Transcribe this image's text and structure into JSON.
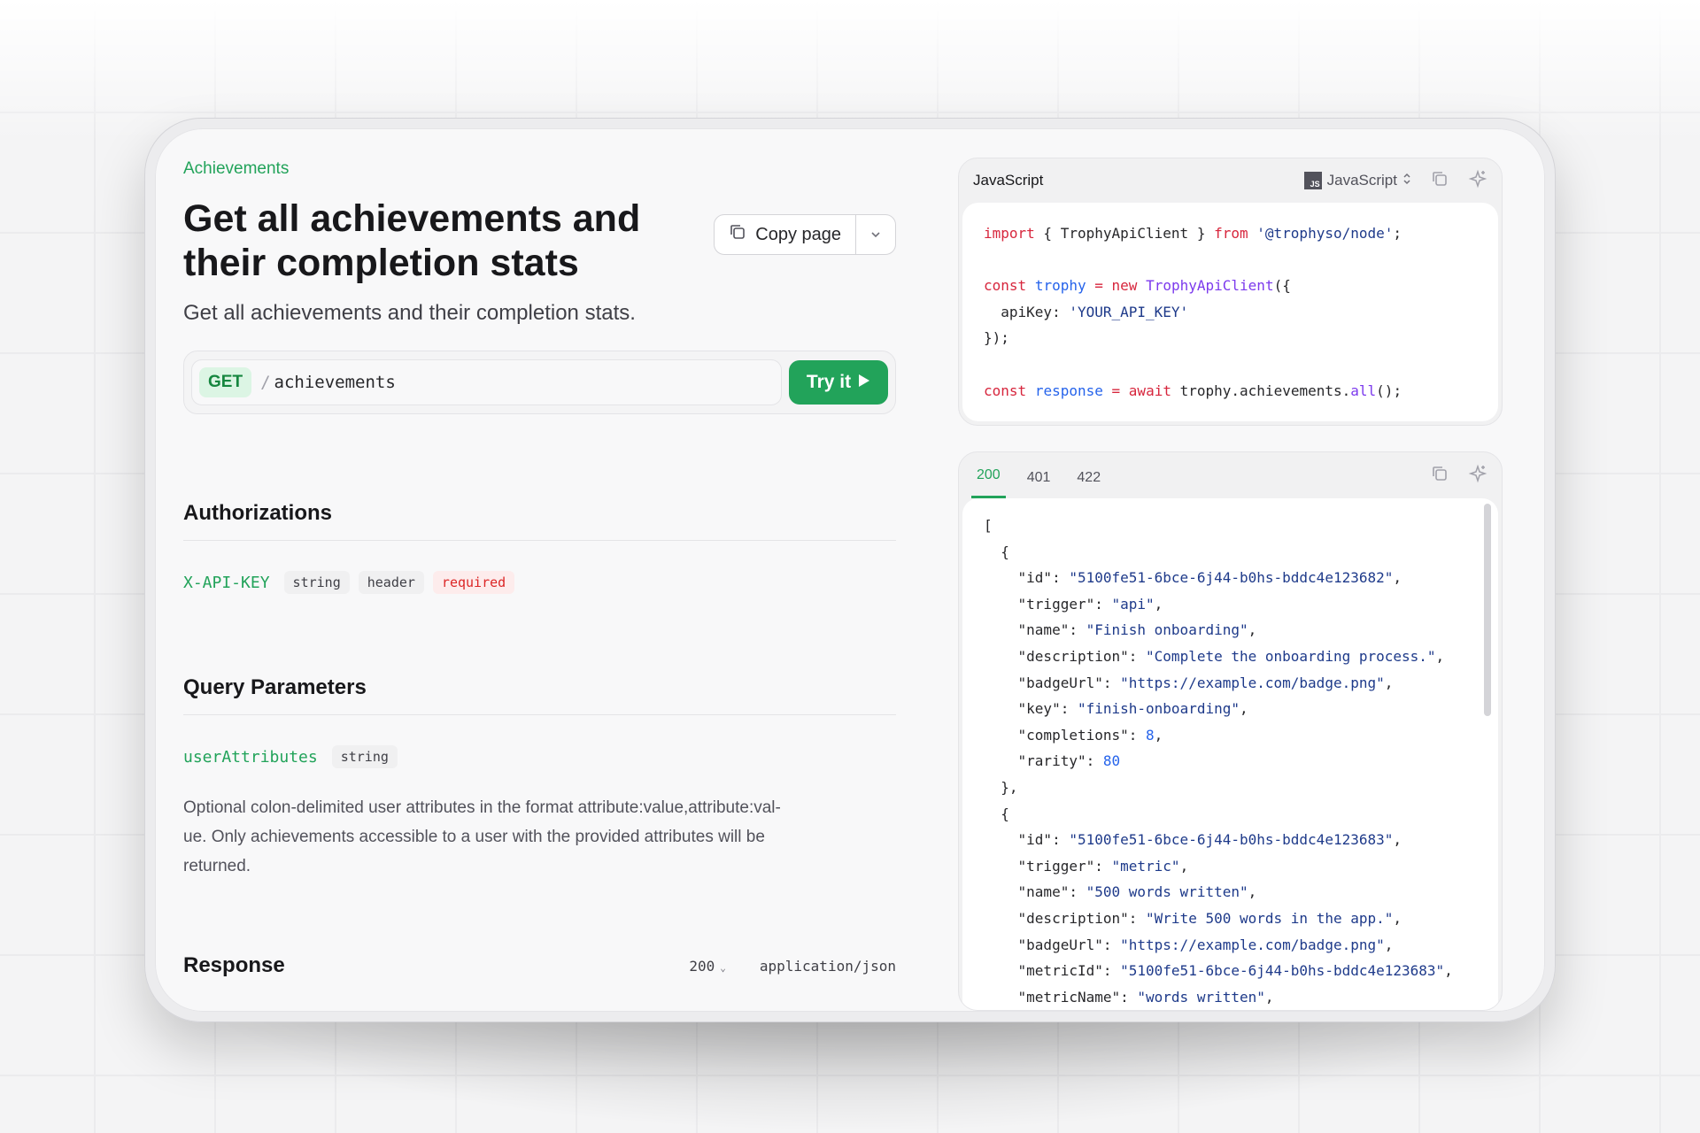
{
  "breadcrumb": "Achievements",
  "page": {
    "title": "Get all achievements and their completion stats",
    "subtitle": "Get all achievements and their completion stats."
  },
  "copy_page": {
    "label": "Copy page"
  },
  "endpoint": {
    "method": "GET",
    "path": "achievements",
    "try_label": "Try it"
  },
  "authorizations": {
    "title": "Authorizations",
    "param": {
      "name": "X-API-KEY",
      "type": "string",
      "location": "header",
      "required": "required"
    }
  },
  "query": {
    "title": "Query Parameters",
    "param": {
      "name": "userAttributes",
      "type": "string"
    },
    "description_lines": [
      "Optional colon-delimited user attributes in the format attribute:value,attribute:val-",
      "ue. Only achievements accessible to a user with the provided attributes will be",
      "returned."
    ]
  },
  "response": {
    "title": "Response",
    "status": "200",
    "content_type": "application/json"
  },
  "code_panel": {
    "title": "JavaScript",
    "language": "JavaScript",
    "lines": [
      [
        {
          "t": "import",
          "c": "kw"
        },
        {
          "t": " { TrophyApiClient } ",
          "c": ""
        },
        {
          "t": "from",
          "c": "kw"
        },
        {
          "t": " ",
          "c": ""
        },
        {
          "t": "'@trophyso/node'",
          "c": "str"
        },
        {
          "t": ";",
          "c": ""
        }
      ],
      [],
      [
        {
          "t": "const",
          "c": "kw"
        },
        {
          "t": " ",
          "c": ""
        },
        {
          "t": "trophy",
          "c": "var"
        },
        {
          "t": " ",
          "c": ""
        },
        {
          "t": "=",
          "c": "kw"
        },
        {
          "t": " ",
          "c": ""
        },
        {
          "t": "new",
          "c": "kw"
        },
        {
          "t": " ",
          "c": ""
        },
        {
          "t": "TrophyApiClient",
          "c": "cls"
        },
        {
          "t": "({",
          "c": ""
        }
      ],
      [
        {
          "t": "  apiKey: ",
          "c": ""
        },
        {
          "t": "'YOUR_API_KEY'",
          "c": "str"
        }
      ],
      [
        {
          "t": "});",
          "c": ""
        }
      ],
      [],
      [
        {
          "t": "const",
          "c": "kw"
        },
        {
          "t": " ",
          "c": ""
        },
        {
          "t": "response",
          "c": "var"
        },
        {
          "t": " ",
          "c": ""
        },
        {
          "t": "=",
          "c": "kw"
        },
        {
          "t": " ",
          "c": ""
        },
        {
          "t": "await",
          "c": "kw"
        },
        {
          "t": " trophy.achievements.",
          "c": ""
        },
        {
          "t": "all",
          "c": "fn"
        },
        {
          "t": "();",
          "c": ""
        }
      ]
    ]
  },
  "response_panel": {
    "tabs": [
      "200",
      "401",
      "422"
    ],
    "active_tab": "200",
    "lines": [
      [
        {
          "t": "[",
          "c": ""
        }
      ],
      [
        {
          "t": "  {",
          "c": ""
        }
      ],
      [
        {
          "t": "    \"id\": ",
          "c": ""
        },
        {
          "t": "\"5100fe51-6bce-6j44-b0hs-bddc4e123682\"",
          "c": "str"
        },
        {
          "t": ",",
          "c": ""
        }
      ],
      [
        {
          "t": "    \"trigger\": ",
          "c": ""
        },
        {
          "t": "\"api\"",
          "c": "str"
        },
        {
          "t": ",",
          "c": ""
        }
      ],
      [
        {
          "t": "    \"name\": ",
          "c": ""
        },
        {
          "t": "\"Finish onboarding\"",
          "c": "str"
        },
        {
          "t": ",",
          "c": ""
        }
      ],
      [
        {
          "t": "    \"description\": ",
          "c": ""
        },
        {
          "t": "\"Complete the onboarding process.\"",
          "c": "str"
        },
        {
          "t": ",",
          "c": ""
        }
      ],
      [
        {
          "t": "    \"badgeUrl\": ",
          "c": ""
        },
        {
          "t": "\"https://example.com/badge.png\"",
          "c": "str"
        },
        {
          "t": ",",
          "c": ""
        }
      ],
      [
        {
          "t": "    \"key\": ",
          "c": ""
        },
        {
          "t": "\"finish-onboarding\"",
          "c": "str"
        },
        {
          "t": ",",
          "c": ""
        }
      ],
      [
        {
          "t": "    \"completions\": ",
          "c": ""
        },
        {
          "t": "8",
          "c": "num"
        },
        {
          "t": ",",
          "c": ""
        }
      ],
      [
        {
          "t": "    \"rarity\": ",
          "c": ""
        },
        {
          "t": "80",
          "c": "num"
        }
      ],
      [
        {
          "t": "  },",
          "c": ""
        }
      ],
      [
        {
          "t": "  {",
          "c": ""
        }
      ],
      [
        {
          "t": "    \"id\": ",
          "c": ""
        },
        {
          "t": "\"5100fe51-6bce-6j44-b0hs-bddc4e123683\"",
          "c": "str"
        },
        {
          "t": ",",
          "c": ""
        }
      ],
      [
        {
          "t": "    \"trigger\": ",
          "c": ""
        },
        {
          "t": "\"metric\"",
          "c": "str"
        },
        {
          "t": ",",
          "c": ""
        }
      ],
      [
        {
          "t": "    \"name\": ",
          "c": ""
        },
        {
          "t": "\"500 words written\"",
          "c": "str"
        },
        {
          "t": ",",
          "c": ""
        }
      ],
      [
        {
          "t": "    \"description\": ",
          "c": ""
        },
        {
          "t": "\"Write 500 words in the app.\"",
          "c": "str"
        },
        {
          "t": ",",
          "c": ""
        }
      ],
      [
        {
          "t": "    \"badgeUrl\": ",
          "c": ""
        },
        {
          "t": "\"https://example.com/badge.png\"",
          "c": "str"
        },
        {
          "t": ",",
          "c": ""
        }
      ],
      [
        {
          "t": "    \"metricId\": ",
          "c": ""
        },
        {
          "t": "\"5100fe51-6bce-6j44-b0hs-bddc4e123683\"",
          "c": "str"
        },
        {
          "t": ",",
          "c": ""
        }
      ],
      [
        {
          "t": "    \"metricName\": ",
          "c": ""
        },
        {
          "t": "\"words written\"",
          "c": "str"
        },
        {
          "t": ",",
          "c": ""
        }
      ]
    ]
  },
  "colors": {
    "accent": "#22a35a",
    "required": "#dc2626",
    "keyword": "#d7263d",
    "string": "#1e3a8a"
  }
}
